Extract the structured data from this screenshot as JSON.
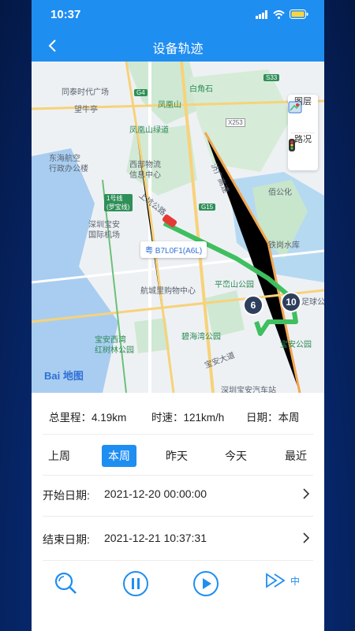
{
  "status_bar": {
    "time": "10:37"
  },
  "header": {
    "title": "设备轨迹"
  },
  "map": {
    "tools": {
      "layers": "图层",
      "traffic": "路况"
    },
    "plate": "粤 B7L0F1(A6L)",
    "clusters": [
      "6",
      "10"
    ],
    "labels": {
      "l1": "同泰时代广场",
      "l2": "望牛亭",
      "l3": "白角石",
      "l4": "凤凰山",
      "l5": "凤凰山绿道",
      "l6": "东海航空",
      "l7": "行政办公楼",
      "l8": "西部物流",
      "l9": "信息中心",
      "l10": "济广高速",
      "l11": "佰公化",
      "l12": "1号线(罗宝线)",
      "l13": "深圳宝安",
      "l14": "国际机场",
      "l15": "上坑公路",
      "l16": "铁岗水库",
      "l17": "平峦山公园",
      "l18": "航城里购物中心",
      "l19": "宝安西湾",
      "l20": "红树林公园",
      "l21": "碧海湾公园",
      "l22": "宝安大道",
      "l23": "宝安公园",
      "l24": "深圳宝安汽车站",
      "l25": "足球公",
      "r1": "G4",
      "r2": "S33",
      "r3": "X253",
      "r4": "G15"
    },
    "baidu": "Bai",
    "baidu2": "地图"
  },
  "stats": {
    "mileage_label": "总里程：",
    "mileage": "4.19km",
    "speed_label": "时速：",
    "speed": "121km/h",
    "date_label": "日期：",
    "date": "本周"
  },
  "tabs": [
    "上周",
    "本周",
    "昨天",
    "今天",
    "最近"
  ],
  "start": {
    "label": "开始日期:",
    "value": "2021-12-20 00:00:00"
  },
  "end": {
    "label": "结束日期:",
    "value": "2021-12-21 10:37:31"
  },
  "playback": {
    "speed_label": "中"
  },
  "colors": {
    "primary": "#1f8ef1",
    "track": "#3fbf5f"
  }
}
